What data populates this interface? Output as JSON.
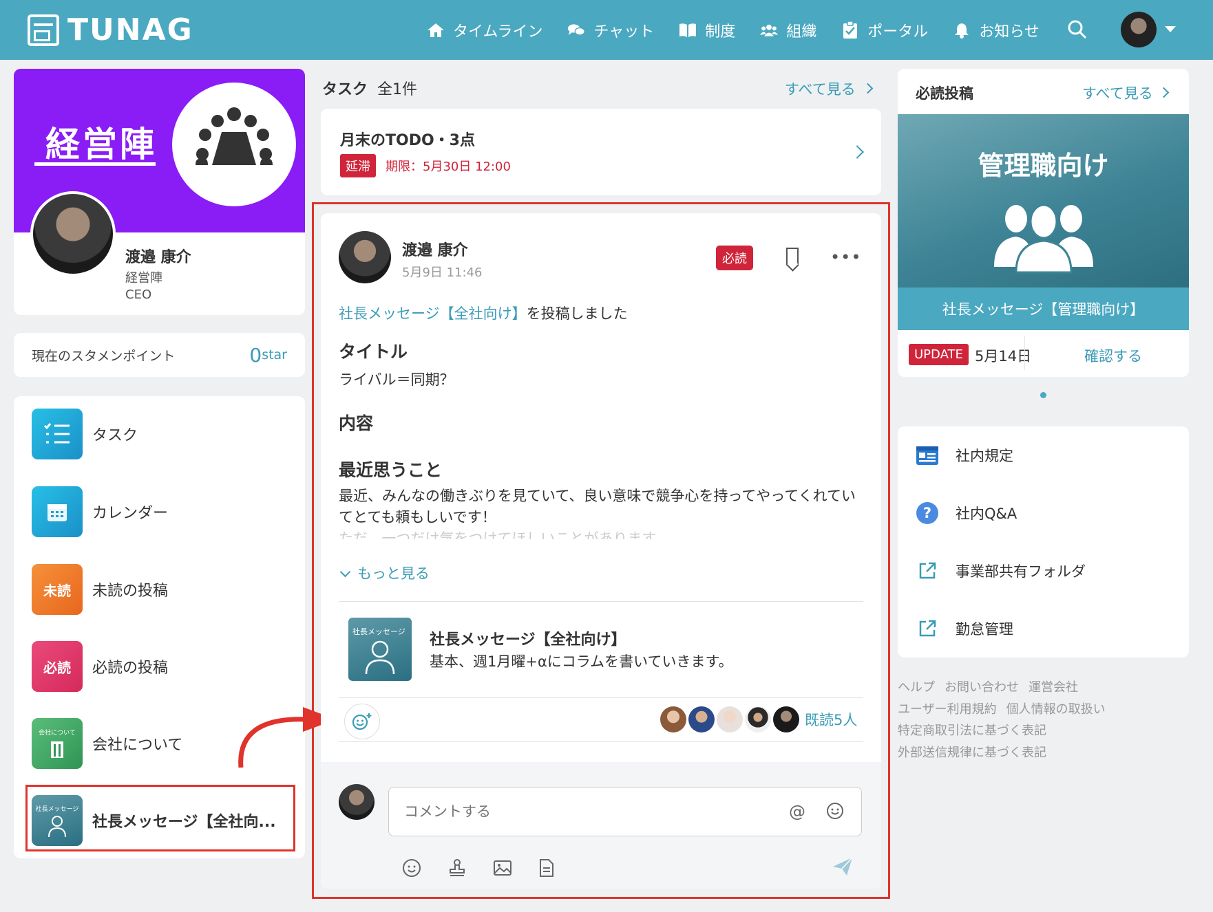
{
  "header": {
    "logo": "TUNAG",
    "nav": [
      {
        "label": "タイムライン",
        "icon": "home-icon"
      },
      {
        "label": "チャット",
        "icon": "chat-icon"
      },
      {
        "label": "制度",
        "icon": "book-icon"
      },
      {
        "label": "組織",
        "icon": "users-icon"
      },
      {
        "label": "ポータル",
        "icon": "clipboard-icon"
      },
      {
        "label": "お知らせ",
        "icon": "bell-icon"
      }
    ]
  },
  "profile": {
    "banner_title": "経営陣",
    "name": "渡邉 康介",
    "dept": "経営陣",
    "role": "CEO"
  },
  "points": {
    "label": "現在のスタメンポイント",
    "value": "0",
    "unit": "star"
  },
  "menu": [
    {
      "label": "タスク",
      "color": "#1ba6d8"
    },
    {
      "label": "カレンダー",
      "color": "#1ba6d8"
    },
    {
      "label": "未読の投稿",
      "icon_text": "未読",
      "color": "#f07a2a"
    },
    {
      "label": "必読の投稿",
      "icon_text": "必読",
      "color": "#e0356a"
    },
    {
      "label": "会社について",
      "icon_text": "会社について",
      "color": "#3aa862"
    },
    {
      "label": "社長メッセージ【全社向...",
      "icon_text": "社長メッセージ",
      "color": "#3a7f92"
    }
  ],
  "tasks": {
    "header": "タスク",
    "count": "全1件",
    "see_all": "すべて見る",
    "item": {
      "title": "月末のTODO・3点",
      "tag": "延滞",
      "due": "期限：5月30日 12:00"
    }
  },
  "post": {
    "author": "渡邉 康介",
    "date": "5月9日 11:46",
    "badge": "必読",
    "action_link": "社長メッセージ【全社向け】",
    "action_suffix": "を投稿しました",
    "title_heading": "タイトル",
    "title_text": "ライバル＝同期？",
    "content_heading": "内容",
    "recent_heading": "最近思うこと",
    "body": "最近、みんなの働きぶりを見ていて、良い意味で競争心を持ってやってくれていてとても頼もしいです！",
    "body_fade": "ただ、一つだけ気をつけてほしいことがあります",
    "see_more": "もっと見る",
    "ref_thumb_text": "社長メッセージ",
    "ref_title": "社長メッセージ【全社向け】",
    "ref_subtitle": "基本、週1月曜+αにコラムを書いていきます。",
    "read_count": "既読5人",
    "comment_placeholder": "コメントする"
  },
  "must_read": {
    "header": "必読投稿",
    "see_all": "すべて見る",
    "image_title": "管理職向け",
    "caption": "社長メッセージ【管理職向け】",
    "update_tag": "UPDATE",
    "update_date": "5月14日",
    "confirm": "確認する"
  },
  "links": [
    {
      "label": "社内規定",
      "icon": "document-card-icon"
    },
    {
      "label": "社内Q&A",
      "icon": "question-icon"
    },
    {
      "label": "事業部共有フォルダ",
      "icon": "external-link-icon"
    },
    {
      "label": "勤怠管理",
      "icon": "external-link-icon"
    }
  ],
  "footer": {
    "row1": [
      "ヘルプ",
      "お問い合わせ",
      "運営会社"
    ],
    "row2": [
      "ユーザー利用規約",
      "個人情報の取扱い"
    ],
    "row3": [
      "特定商取引法に基づく表記"
    ],
    "row4": [
      "外部送信規律に基づく表記"
    ]
  },
  "colors": {
    "brand": "#4aa8c0",
    "accent": "#3a9bb6",
    "alert": "#d0243a",
    "banner": "#8a1cf6",
    "highlight": "#e0332b"
  }
}
